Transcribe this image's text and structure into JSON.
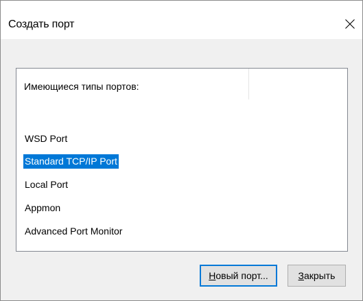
{
  "window": {
    "title": "Создать порт",
    "close_glyph": "X"
  },
  "list": {
    "header": "Имеющиеся типы портов:",
    "items": [
      {
        "label": "WSD Port",
        "selected": false
      },
      {
        "label": "Standard TCP/IP Port",
        "selected": true
      },
      {
        "label": "Local Port",
        "selected": false
      },
      {
        "label": "Appmon",
        "selected": false
      },
      {
        "label": "Advanced Port Monitor",
        "selected": false
      }
    ]
  },
  "buttons": {
    "new_port": {
      "first": "Н",
      "rest": "овый порт..."
    },
    "close": {
      "first": "З",
      "rest": "акрыть"
    }
  },
  "colors": {
    "selection": "#0078d7",
    "default_button_border": "#0078d7",
    "dialog_background": "#f0f0f0"
  }
}
